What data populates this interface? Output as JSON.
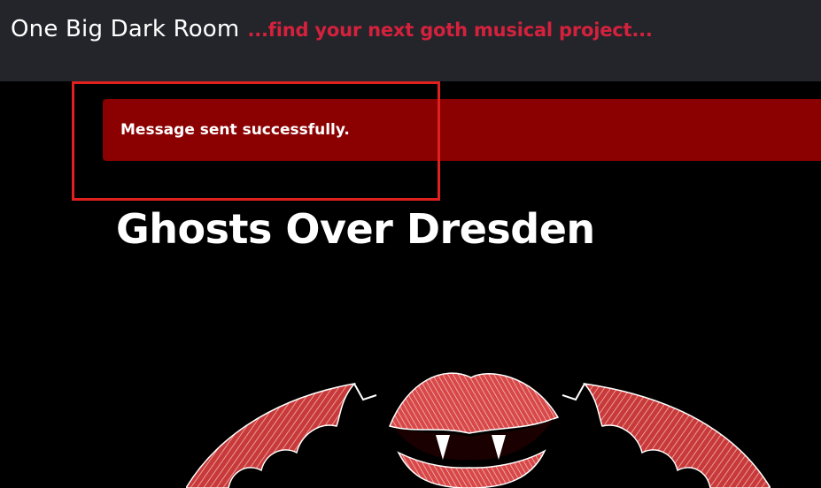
{
  "header": {
    "site_title": "One Big Dark Room",
    "tagline": "...find your next goth musical project..."
  },
  "alert": {
    "message": "Message sent successfully."
  },
  "main": {
    "title": "Ghosts Over Dresden",
    "artwork_icon": "vampire-lips-bat-wings-icon"
  },
  "colors": {
    "header_bg": "#23252a",
    "tagline": "#d4213d",
    "alert_bg": "#8b0000",
    "highlight_border": "#e0201e",
    "page_bg": "#000000",
    "artwork_red": "#e04848"
  }
}
